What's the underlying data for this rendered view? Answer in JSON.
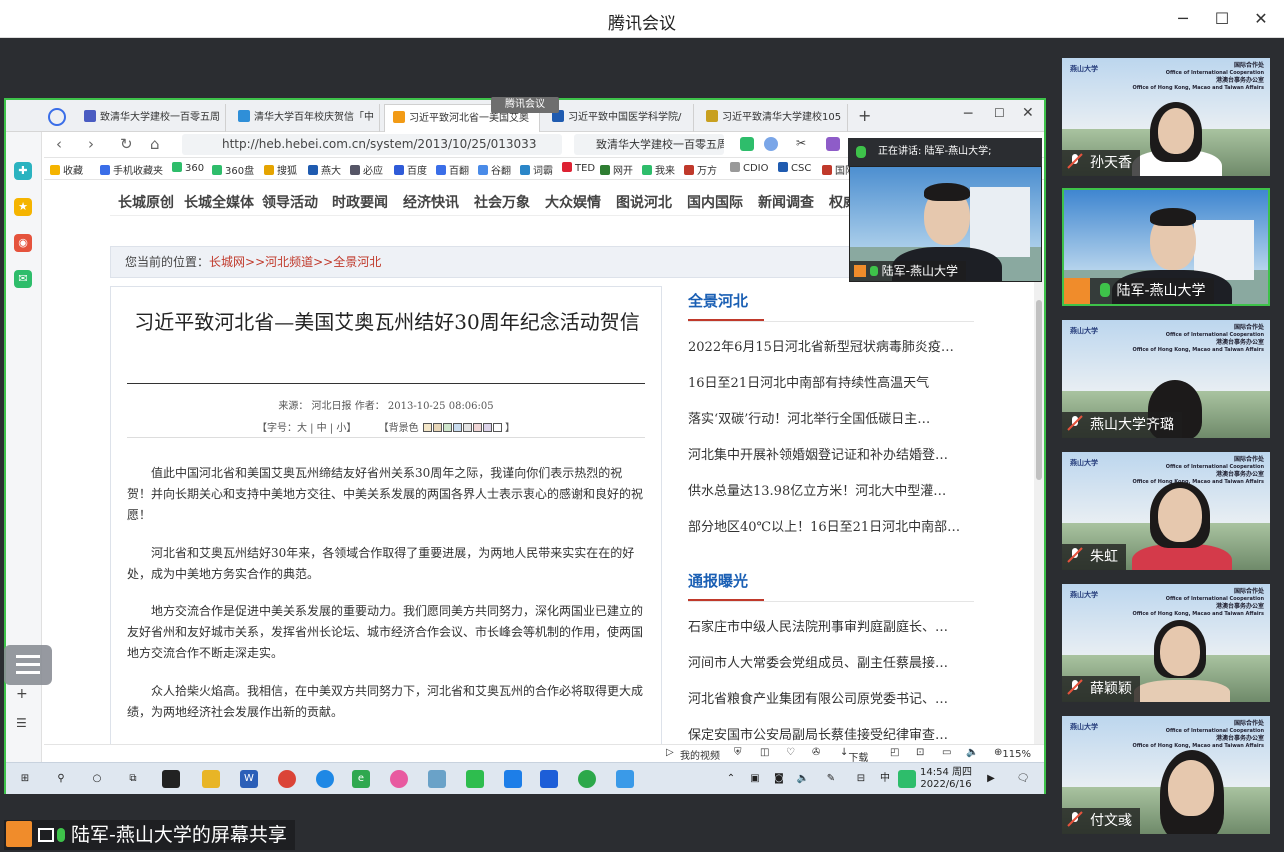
{
  "app": {
    "title": "腾讯会议"
  },
  "browser": {
    "tabs": [
      {
        "label": "致清华大学建校一百零五周"
      },
      {
        "label": "清华大学百年校庆贺信「中"
      },
      {
        "label": "习近平致河北省一美国艾奥"
      },
      {
        "label": "习近平致中国医学科学院/"
      },
      {
        "label": "习近平致清华大学建校105"
      }
    ],
    "url": "http://heb.hebei.com.cn/system/2013/10/25/013033",
    "search": "致清华大学建校一百零五周年",
    "bookmarks": [
      "收藏",
      "手机收藏夹",
      "360",
      "360盘",
      "搜狐",
      "燕大",
      "必应",
      "百度",
      "百翻",
      "谷翻",
      "词霸",
      "TED",
      "网开",
      "我来",
      "万方",
      "CDIO",
      "CSC",
      "国际"
    ],
    "status": {
      "video": "我的视频",
      "download": "下载",
      "zoom": "115%"
    }
  },
  "site": {
    "nav": [
      "长城原创",
      "长城全媒体",
      "领导活动",
      "时政要闻",
      "经济快讯",
      "社会万象",
      "大众娱情",
      "图说河北",
      "国内国际",
      "新闻调查",
      "权威"
    ],
    "crumb_prefix": "您当前的位置：",
    "crumb_links": "长城网>>河北频道>>全景河北"
  },
  "article": {
    "title": "习近平致河北省—美国艾奥瓦州结好30周年纪念活动贺信",
    "meta": "来源：  河北日报      作者：        2013-10-25  08:06:05",
    "font_size": "【字号：大 | 中 | 小】",
    "bg_color": "【背景色",
    "bg_end": "】",
    "paragraphs": [
      "值此中国河北省和美国艾奥瓦州缔结友好省州关系30周年之际，我谨向你们表示热烈的祝贺！并向长期关心和支持中美地方交往、中美关系发展的两国各界人士表示衷心的感谢和良好的祝愿！",
      "河北省和艾奥瓦州结好30年来，各领域合作取得了重要进展，为两地人民带来实实在在的好处，成为中美地方务实合作的典范。",
      "地方交流合作是促进中美关系发展的重要动力。我们愿同美方共同努力，深化两国业已建立的友好省州和友好城市关系，发挥省州长论坛、城市经济合作会议、市长峰会等机制的作用，使两国地方交流合作不断走深走实。",
      "众人拾柴火焰高。我相信，在中美双方共同努力下，河北省和艾奥瓦州的合作必将取得更大成绩，为两地经济社会发展作出新的贡献。"
    ]
  },
  "sidebar_lists": [
    {
      "heading": "全景河北",
      "items": [
        "2022年6月15日河北省新型冠状病毒肺炎疫…",
        "16日至21日河北中南部有持续性高温天气",
        "落实‘双碳’行动！河北举行全国低碳日主…",
        "河北集中开展补领婚姻登记证和补办结婚登…",
        "供水总量达13.98亿立方米！河北大中型灌…",
        "部分地区40℃以上！16日至21日河北中南部…"
      ]
    },
    {
      "heading": "通报曝光",
      "items": [
        "石家庄市中级人民法院刑事审判庭副庭长、…",
        "河间市人大常委会党组成员、副主任蔡晨接…",
        "河北省粮食产业集团有限公司原党委书记、…",
        "保定安国市公安局副局长蔡佳接受纪律审查…"
      ]
    }
  ],
  "taskbar": {
    "time": "14:54 周四",
    "date": "2022/6/16"
  },
  "meeting": {
    "tiny_label": "腾讯会议",
    "speaking": "正在讲话: 陆军-燕山大学;",
    "pip_name": "陆军-燕山大学",
    "share_label": "陆军-燕山大学的屏幕共享",
    "office": {
      "line1": "国际合作处",
      "line2": "Office of International Cooperation",
      "line3": "港澳台事务办公室",
      "line4": "Office of Hong Kong, Macao and Taiwan Affairs",
      "logo": "燕山大学"
    },
    "participants": [
      {
        "name": "孙天香"
      },
      {
        "name": "陆军-燕山大学"
      },
      {
        "name": "燕山大学齐璐"
      },
      {
        "name": "朱虹"
      },
      {
        "name": "薛颖颖"
      },
      {
        "name": "付文彧"
      }
    ]
  },
  "colors": {
    "accent": "#3ec24a",
    "link_red": "#c0392b",
    "heading_blue": "#1a5fb4",
    "user_orange": "#f08c2b"
  }
}
